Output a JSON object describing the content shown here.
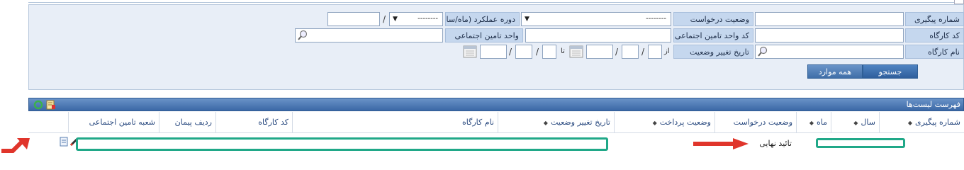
{
  "search": {
    "tracking_number_label": "شماره پیگیری",
    "request_status_label": "وضعیت درخواست",
    "request_status_value": "--------",
    "period_label": "دوره عملکرد (ماه/سال)",
    "period_month_value": "--------",
    "workshop_code_label": "کد کارگاه",
    "insurance_unit_code_label": "کد واحد تامین اجتماعی",
    "insurance_unit_label": "واحد تامین اجتماعی",
    "workshop_name_label": "نام کارگاه",
    "status_change_date_label": "تاریخ تغییر وضعیت",
    "from_label": "از",
    "to_label": "تا",
    "slash": "/",
    "search_button": "جستجو",
    "all_button": "همه موارد"
  },
  "list": {
    "title": "فهرست لیست‌ها",
    "columns": [
      {
        "label": "شماره پیگیری",
        "sortable": true
      },
      {
        "label": "سال",
        "sortable": true
      },
      {
        "label": "ماه",
        "sortable": true
      },
      {
        "label": "وضعیت درخواست",
        "sortable": false
      },
      {
        "label": "وضعیت پرداخت",
        "sortable": true
      },
      {
        "label": "تاریخ تغییر وضعیت",
        "sortable": true
      },
      {
        "label": "نام کارگاه",
        "sortable": false
      },
      {
        "label": "کد کارگاه",
        "sortable": false
      },
      {
        "label": "ردیف پیمان",
        "sortable": false
      },
      {
        "label": "شعبه تامین اجتماعی",
        "sortable": false
      }
    ],
    "rows": [
      {
        "request_status": "تائید نهایی"
      }
    ]
  },
  "annotation_colors": {
    "highlight_box": "#20a888",
    "arrow": "#e0352b"
  },
  "icons": [
    "magnifier-icon",
    "calendar-icon",
    "refresh-icon",
    "export-icon",
    "edit-icon",
    "view-icon"
  ]
}
